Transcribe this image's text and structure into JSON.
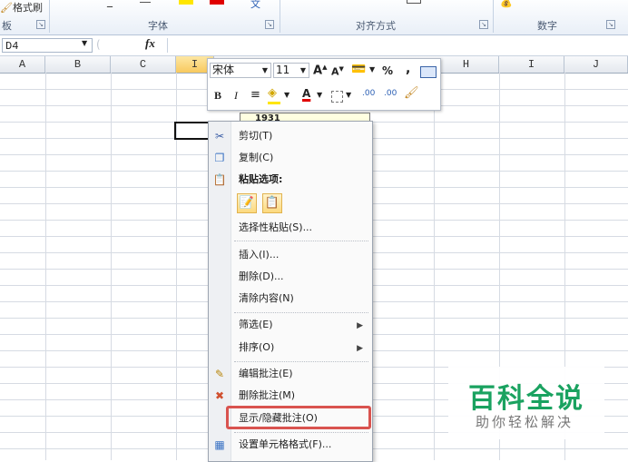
{
  "ribbon": {
    "format_painter_label": "格式刷",
    "clipboard_label": "板",
    "font_group_label": "字体",
    "align_group_label": "对齐方式",
    "number_group_label": "数字"
  },
  "formula_bar": {
    "name_box": "D4",
    "fx_label": "fx"
  },
  "columns": [
    "A",
    "B",
    "C",
    "I",
    "H",
    "I",
    "J"
  ],
  "mini_toolbar": {
    "font_name": "宋体",
    "font_size": "11",
    "grow_font": "A",
    "shrink_font": "A",
    "percent": "%",
    "comma": ",",
    "bold": "B",
    "italic": "I",
    "font_color": "A",
    "inc_decimal": ".00",
    "dec_decimal": ".00"
  },
  "comment": {
    "text": "1931"
  },
  "context_menu": {
    "cut": "剪切(T)",
    "copy": "复制(C)",
    "paste_options": "粘贴选项:",
    "paste_special": "选择性粘贴(S)...",
    "insert": "插入(I)...",
    "delete": "删除(D)...",
    "clear": "清除内容(N)",
    "filter": "筛选(E)",
    "sort": "排序(O)",
    "edit_comment": "编辑批注(E)",
    "delete_comment": "删除批注(M)",
    "show_hide_comment": "显示/隐藏批注(O)",
    "format_cells": "设置单元格格式(F)..."
  },
  "watermark": {
    "title": "百科全说",
    "subtitle": "助你轻松解决"
  },
  "colors": {
    "highlight": "#d9534f",
    "watermark_green": "#1aa260",
    "selected_col": "#f8c95e"
  }
}
